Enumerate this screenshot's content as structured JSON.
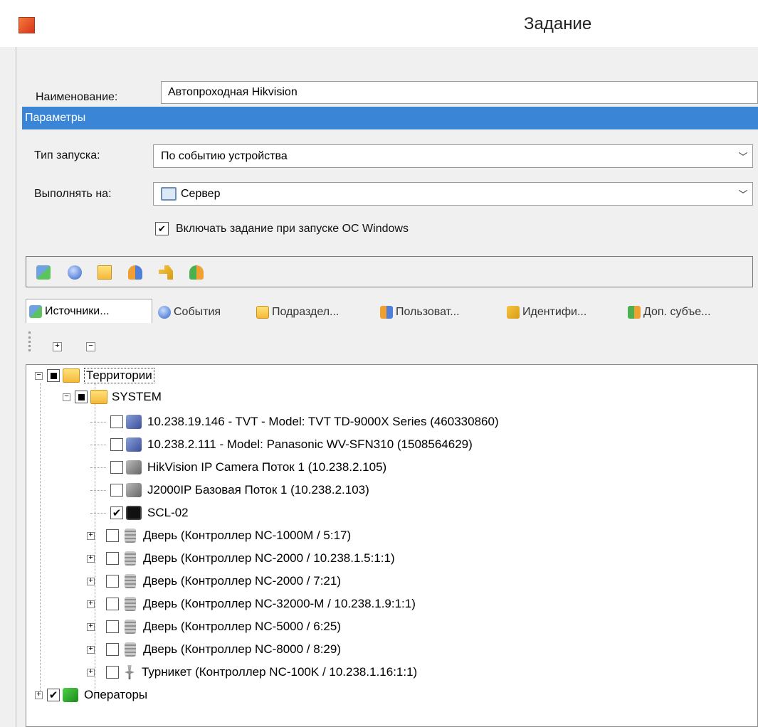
{
  "window": {
    "title": "Задание"
  },
  "name_field": {
    "label": "Наименование:",
    "value": "Автопроходная Hikvision"
  },
  "section": {
    "title": "Параметры"
  },
  "launch_type": {
    "label": "Тип запуска:",
    "value": "По событию устройства"
  },
  "execute_on": {
    "label": "Выполнять на:",
    "value": "Сервер"
  },
  "windows_start": {
    "label": "Включать задание при запуске ОС Windows",
    "checked": true
  },
  "toolbar": {
    "icons": [
      "sources-icon",
      "events-icon",
      "folder-icon",
      "users-icon",
      "keys-icon",
      "subjects-icon"
    ]
  },
  "tabs": [
    {
      "label": "Источники...",
      "icon": "sources-icon",
      "active": true
    },
    {
      "label": "События",
      "icon": "events-icon"
    },
    {
      "label": "Подраздел...",
      "icon": "folder-icon"
    },
    {
      "label": "Пользоват...",
      "icon": "users-icon"
    },
    {
      "label": "Идентифи...",
      "icon": "keys-icon"
    },
    {
      "label": "Доп. субъе...",
      "icon": "subjects-icon"
    }
  ],
  "tree_toolbar": {
    "expand": "+",
    "collapse": "−"
  },
  "tree": {
    "root": {
      "label": "Территории",
      "state": "partial"
    },
    "system": {
      "label": "SYSTEM",
      "state": "partial"
    },
    "items": [
      {
        "label": "10.238.19.146 - TVT - Model: TVT TD-9000X Series (460330860)",
        "checked": false,
        "icon": "camera-icon",
        "expandable": false
      },
      {
        "label": "10.238.2.111 - Model: Panasonic WV-SFN310 (1508564629)",
        "checked": false,
        "icon": "camera-icon",
        "expandable": false
      },
      {
        "label": "HikVision IP Camera Поток 1 (10.238.2.105)",
        "checked": false,
        "icon": "camera-gray-icon",
        "expandable": false
      },
      {
        "label": "J2000IP Базовая Поток 1 (10.238.2.103)",
        "checked": false,
        "icon": "camera-gray-icon",
        "expandable": false
      },
      {
        "label": "SCL-02",
        "checked": true,
        "icon": "terminal-icon",
        "expandable": false
      },
      {
        "label": "Дверь (Контроллер NC-1000M / 5:17)",
        "checked": false,
        "icon": "door-icon",
        "expandable": true
      },
      {
        "label": "Дверь (Контроллер NC-2000 / 10.238.1.5:1:1)",
        "checked": false,
        "icon": "door-icon",
        "expandable": true
      },
      {
        "label": "Дверь (Контроллер NC-2000 / 7:21)",
        "checked": false,
        "icon": "door-icon",
        "expandable": true
      },
      {
        "label": "Дверь (Контроллер NC-32000-M / 10.238.1.9:1:1)",
        "checked": false,
        "icon": "door-icon",
        "expandable": true
      },
      {
        "label": "Дверь (Контроллер NC-5000 / 6:25)",
        "checked": false,
        "icon": "door-icon",
        "expandable": true
      },
      {
        "label": "Дверь (Контроллер NC-8000 / 8:29)",
        "checked": false,
        "icon": "door-icon",
        "expandable": true
      },
      {
        "label": "Турникет (Контроллер NC-100K / 10.238.1.16:1:1)",
        "checked": false,
        "icon": "turnstile-icon",
        "expandable": true
      }
    ],
    "operators": {
      "label": "Операторы",
      "checked": true
    }
  }
}
